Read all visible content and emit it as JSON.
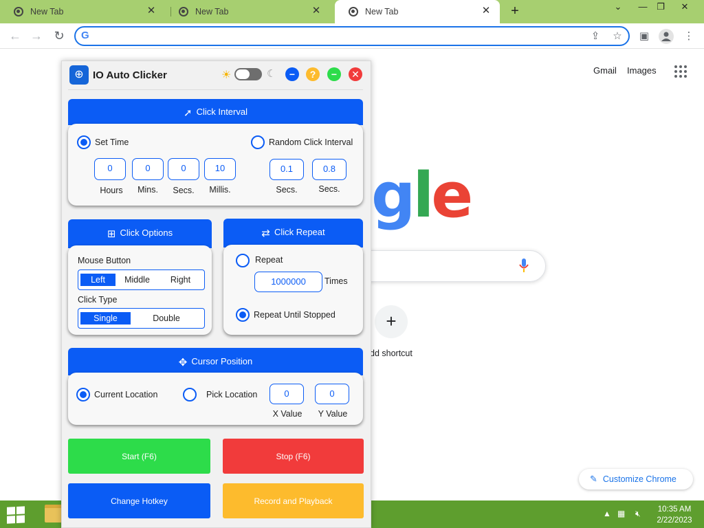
{
  "browser": {
    "tabs": [
      {
        "title": "New Tab"
      },
      {
        "title": "New Tab"
      },
      {
        "title": "New Tab"
      }
    ],
    "new_tab_symbol": "+",
    "window_buttons": {
      "dropdown": "⌄",
      "minimize": "—",
      "restore": "❐",
      "close": "✕"
    },
    "omnibox": {
      "value": "",
      "placeholder": ""
    }
  },
  "google": {
    "gmail": "Gmail",
    "images": "Images",
    "logo_visible": "gle",
    "add_shortcut": "dd shortcut",
    "customize": "Customize Chrome"
  },
  "app": {
    "title": "IO Auto Clicker",
    "click_interval": {
      "header": "Click Interval",
      "set_time_label": "Set Time",
      "random_label": "Random Click Interval",
      "set_time_selected": true,
      "fields": [
        {
          "value": "0",
          "unit": "Hours"
        },
        {
          "value": "0",
          "unit": "Mins."
        },
        {
          "value": "0",
          "unit": "Secs."
        },
        {
          "value": "10",
          "unit": "Millis."
        }
      ],
      "random_fields": [
        {
          "value": "0.1",
          "unit": "Secs."
        },
        {
          "value": "0.8",
          "unit": "Secs."
        }
      ]
    },
    "click_options": {
      "header": "Click Options",
      "mouse_button_label": "Mouse Button",
      "mouse_buttons": [
        "Left",
        "Middle",
        "Right"
      ],
      "mouse_selected": "Left",
      "click_type_label": "Click Type",
      "click_types": [
        "Single",
        "Double"
      ],
      "click_type_selected": "Single"
    },
    "click_repeat": {
      "header": "Click Repeat",
      "repeat_label": "Repeat",
      "repeat_value": "1000000",
      "times_label": "Times",
      "until_stopped_label": "Repeat Until Stopped",
      "selected": "until_stopped"
    },
    "cursor_position": {
      "header": "Cursor Position",
      "current_label": "Current Location",
      "pick_label": "Pick Location",
      "selected": "current",
      "x_value": "0",
      "y_value": "0",
      "x_label": "X Value",
      "y_label": "Y Value"
    },
    "buttons": {
      "start": "Start (F6)",
      "stop": "Stop (F6)",
      "hotkey": "Change Hotkey",
      "record": "Record and Playback"
    }
  },
  "taskbar": {
    "time": "10:35 AM",
    "date": "2/22/2023"
  },
  "colors": {
    "tabstrip": "#a7cf70",
    "accent_blue": "#0b5cf5",
    "start_green": "#2ddc4a",
    "stop_red": "#f13b3b",
    "hotkey_blue": "#0a5cf5",
    "record_yellow": "#fdbb2d",
    "taskbar": "#5e9e2e"
  }
}
